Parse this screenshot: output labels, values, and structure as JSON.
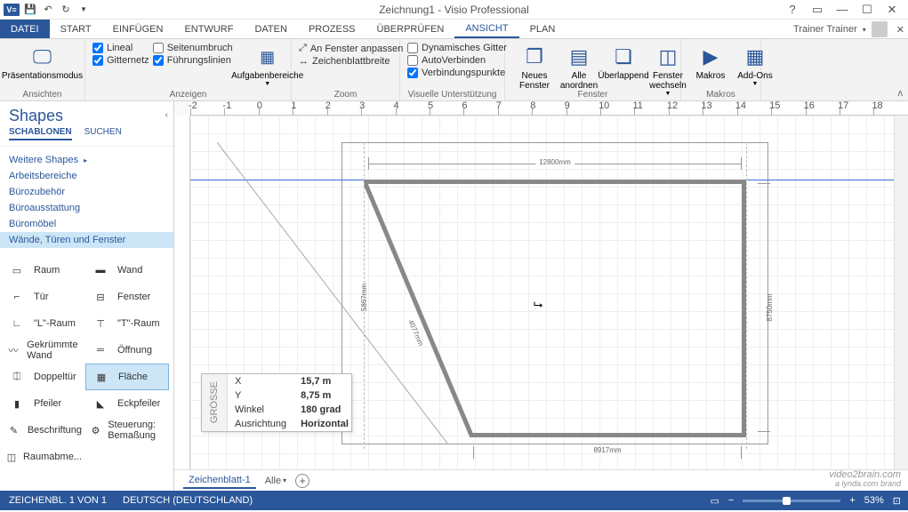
{
  "title": "Zeichnung1 - Visio Professional",
  "user": "Trainer Trainer",
  "tabs": {
    "file": "DATEI",
    "start": "START",
    "einf": "EINFÜGEN",
    "entwurf": "ENTWURF",
    "daten": "DATEN",
    "prozess": "PROZESS",
    "ueberpr": "ÜBERPRÜFEN",
    "ansicht": "ANSICHT",
    "plan": "PLAN"
  },
  "ribbon": {
    "ansichten": {
      "label": "Ansichten",
      "pres": "Präsentationsmodus"
    },
    "anzeigen": {
      "label": "Anzeigen",
      "lineal": "Lineal",
      "gitter": "Gitternetz",
      "seiten": "Seitenumbruch",
      "fuehr": "Führungslinien",
      "aufg": "Aufgabenbereiche"
    },
    "zoom": {
      "label": "Zoom",
      "fenster": "An Fenster anpassen",
      "blatt": "Zeichenblattbreite"
    },
    "visuelle": {
      "label": "Visuelle Unterstützung",
      "dyn": "Dynamisches Gitter",
      "auto": "AutoVerbinden",
      "verb": "Verbindungspunkte"
    },
    "fenster": {
      "label": "Fenster",
      "neu": "Neues Fenster",
      "alle": "Alle anordnen",
      "ueber": "Überlappend",
      "wechsel": "Fenster wechseln"
    },
    "makros": {
      "label": "Makros",
      "mak": "Makros",
      "addon": "Add-Ons"
    }
  },
  "shapes": {
    "title": "Shapes",
    "tab_stencils": "SCHABLONEN",
    "tab_search": "SUCHEN",
    "more": "Weitere Shapes",
    "cats": [
      "Arbeitsbereiche",
      "Bürozubehör",
      "Büroausstattung",
      "Büromöbel",
      "Wände, Türen und Fenster"
    ],
    "grid": [
      {
        "l": "Raum"
      },
      {
        "l": "Wand"
      },
      {
        "l": "Tür"
      },
      {
        "l": "Fenster"
      },
      {
        "l": "\"L\"-Raum"
      },
      {
        "l": "\"T\"-Raum"
      },
      {
        "l": "Gekrümmte Wand"
      },
      {
        "l": "Öffnung"
      },
      {
        "l": "Doppeltür"
      },
      {
        "l": "Fläche"
      },
      {
        "l": "Pfeiler"
      },
      {
        "l": "Eckpfeiler"
      },
      {
        "l": "Beschriftung"
      },
      {
        "l": "Steuerung: Bemaßung"
      },
      {
        "l": "Raumabme..."
      }
    ]
  },
  "floatbox": {
    "side": "GRÖSSE",
    "rows": [
      {
        "k": "X",
        "v": "15,7 m"
      },
      {
        "k": "Y",
        "v": "8,75 m"
      },
      {
        "k": "Winkel",
        "v": "180 grad"
      },
      {
        "k": "Ausrichtung",
        "v": "Horizontal"
      }
    ]
  },
  "dims": {
    "top": "12800mm",
    "right": "8750mm",
    "bot": "8917mm",
    "left": "5867mm",
    "diag": "4077mm"
  },
  "sheet": {
    "tab": "Zeichenblatt-1",
    "all": "Alle"
  },
  "status": {
    "page": "ZEICHENBL. 1 VON 1",
    "lang": "DEUTSCH (DEUTSCHLAND)",
    "zoom": "53%"
  },
  "watermark": {
    "a": "video2brain.com",
    "b": "a lynda.com brand"
  },
  "ruler": [
    "-2",
    "-1",
    "0",
    "1",
    "2",
    "3",
    "4",
    "5",
    "6",
    "7",
    "8",
    "9",
    "10",
    "11",
    "12",
    "13",
    "14",
    "15",
    "16",
    "17",
    "18"
  ]
}
